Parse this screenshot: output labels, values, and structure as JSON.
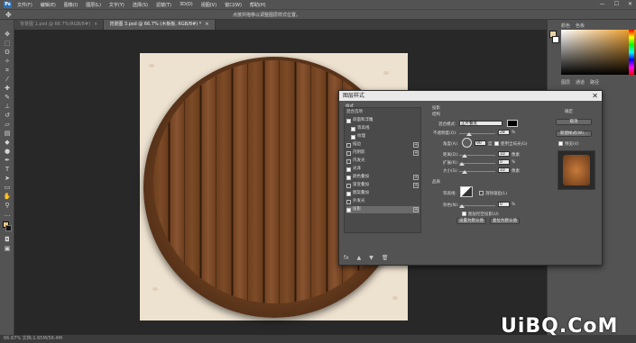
{
  "app": {
    "logo_text": "Ps"
  },
  "menu": {
    "items": [
      "文件(F)",
      "编辑(E)",
      "图像(I)",
      "图层(L)",
      "文字(Y)",
      "选择(S)",
      "滤镜(T)",
      "3D(D)",
      "视图(V)",
      "窗口(W)",
      "帮助(H)"
    ]
  },
  "window_controls": {
    "minimize": "—",
    "maximize": "☐",
    "close": "✕"
  },
  "options_bar": {
    "hint": "点按并拖移以调整图层样式位置。"
  },
  "tabs": [
    {
      "label": "背景图 1.psd @ 66.7%(RGB/8#)",
      "close": "×"
    },
    {
      "label": "背景图 3.psd @ 66.7% (木板板, RGB/8#) *",
      "close": "×"
    }
  ],
  "status_bar": {
    "text": "66.67%    文档:1.65M/56.4M"
  },
  "right_panel": {
    "tabs": [
      "颜色",
      "色板"
    ],
    "tabs2": [
      "图层",
      "通道",
      "路径"
    ]
  },
  "dialog": {
    "title": "图层样式",
    "close": "✕",
    "styles_header": "样式",
    "blend_options": "混合选项",
    "style_items": [
      {
        "label": "斜面和浮雕",
        "checked": true,
        "plus": false
      },
      {
        "label": "等高线",
        "checked": true,
        "plus": false,
        "indent": true
      },
      {
        "label": "纹理",
        "checked": true,
        "plus": false,
        "indent": true
      },
      {
        "label": "描边",
        "checked": false,
        "plus": true
      },
      {
        "label": "内阴影",
        "checked": false,
        "plus": true
      },
      {
        "label": "内发光",
        "checked": false,
        "plus": false
      },
      {
        "label": "光泽",
        "checked": true,
        "plus": false
      },
      {
        "label": "颜色叠加",
        "checked": true,
        "plus": true
      },
      {
        "label": "渐变叠加",
        "checked": false,
        "plus": true
      },
      {
        "label": "图案叠加",
        "checked": true,
        "plus": false
      },
      {
        "label": "外发光",
        "checked": false,
        "plus": false
      },
      {
        "label": "投影",
        "checked": true,
        "plus": true,
        "selected": true
      }
    ],
    "bottom_icons": [
      "fx",
      "▲",
      "▼",
      "🗑"
    ],
    "section_title": "投影",
    "structure_title": "结构",
    "quality_title": "品质",
    "structure": {
      "blend_mode_label": "混合模式:",
      "blend_mode_value": "正片叠底",
      "opacity_label": "不透明度(O):",
      "opacity_value": "28",
      "angle_label": "角度(A):",
      "angle_value": "90",
      "global_light_label": "使用全局光(G)",
      "distance_label": "距离(D):",
      "distance_value": "10",
      "spread_label": "扩展(R):",
      "spread_value": "0",
      "size_label": "大小(S):",
      "size_value": "10",
      "unit_pct": "%",
      "unit_px": "像素",
      "unit_deg": "度"
    },
    "quality": {
      "contour_label": "等高线:",
      "antialias_label": "消除锯齿(L)",
      "noise_label": "杂色(N):",
      "noise_value": "0",
      "knockout_label": "图层挖空投影(U)",
      "default_btn": "设置为默认值",
      "reset_btn": "复位为默认值"
    },
    "right": {
      "ok": "确定",
      "cancel": "取消",
      "new_style": "新建样式(W)...",
      "preview_label": "预览(V)"
    }
  },
  "watermark": "UiBQ.CoM",
  "colors": {
    "accent": "#2b6fb6",
    "wood": "#6e4020",
    "paper": "#ede1cf"
  }
}
